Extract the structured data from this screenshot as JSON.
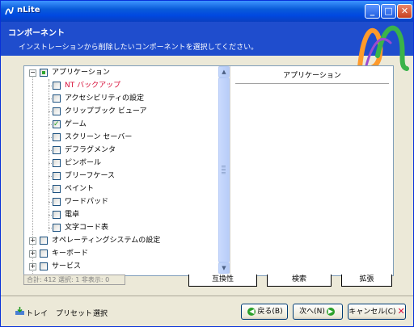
{
  "window": {
    "title": "nLite"
  },
  "header": {
    "title": "コンポーネント",
    "subtitle": "インストレーションから削除したいコンポーネントを選択してください。"
  },
  "tree": {
    "items": [
      {
        "label": "アプリケーション",
        "level": 0,
        "state": "partial",
        "expanded": true,
        "highlight": false
      },
      {
        "label": "NT バックアップ",
        "level": 1,
        "state": "unchecked",
        "highlight": true
      },
      {
        "label": "アクセシビリティの設定",
        "level": 1,
        "state": "unchecked",
        "highlight": false
      },
      {
        "label": "クリップブック ビューア",
        "level": 1,
        "state": "unchecked",
        "highlight": false
      },
      {
        "label": "ゲーム",
        "level": 1,
        "state": "checked",
        "highlight": false
      },
      {
        "label": "スクリーン セーバー",
        "level": 1,
        "state": "unchecked",
        "highlight": false
      },
      {
        "label": "デフラグメンタ",
        "level": 1,
        "state": "unchecked",
        "highlight": false
      },
      {
        "label": "ピンボール",
        "level": 1,
        "state": "unchecked",
        "highlight": false
      },
      {
        "label": "ブリーフケース",
        "level": 1,
        "state": "unchecked",
        "highlight": false
      },
      {
        "label": "ペイント",
        "level": 1,
        "state": "unchecked",
        "highlight": false
      },
      {
        "label": "ワードパッド",
        "level": 1,
        "state": "unchecked",
        "highlight": false
      },
      {
        "label": "電卓",
        "level": 1,
        "state": "unchecked",
        "highlight": false
      },
      {
        "label": "文字コード表",
        "level": 1,
        "state": "unchecked",
        "highlight": false
      },
      {
        "label": "オペレーティングシステムの設定",
        "level": 0,
        "state": "unchecked",
        "expanded": false,
        "highlight": false
      },
      {
        "label": "キーボード",
        "level": 0,
        "state": "unchecked",
        "expanded": false,
        "highlight": false
      },
      {
        "label": "サービス",
        "level": 0,
        "state": "unchecked",
        "expanded": false,
        "highlight": false
      }
    ]
  },
  "description": {
    "header": "アプリケーション"
  },
  "status": {
    "text": "合計: 412 選択: 1 非表示: 0"
  },
  "tabs": [
    {
      "label": "互換性"
    },
    {
      "label": "検索"
    },
    {
      "label": "拡張"
    }
  ],
  "footer": {
    "tray_label": "トレイ",
    "preset_label": "プリセット",
    "select_label": "選択",
    "back_label": "戻る(B)",
    "next_label": "次へ(N)",
    "cancel_label": "キャンセル(C)"
  },
  "icons": {
    "app": "nlite-app-icon",
    "logo": "nlite-logo-icon",
    "tray": "tray-icon",
    "back": "back-arrow-icon",
    "next": "next-arrow-icon",
    "cancel": "cancel-x-icon"
  },
  "colors": {
    "titlebar": "#0a5bd9",
    "header_bg": "#1f4dcd",
    "highlight_text": "#d8103a",
    "check_green": "#21a121"
  }
}
